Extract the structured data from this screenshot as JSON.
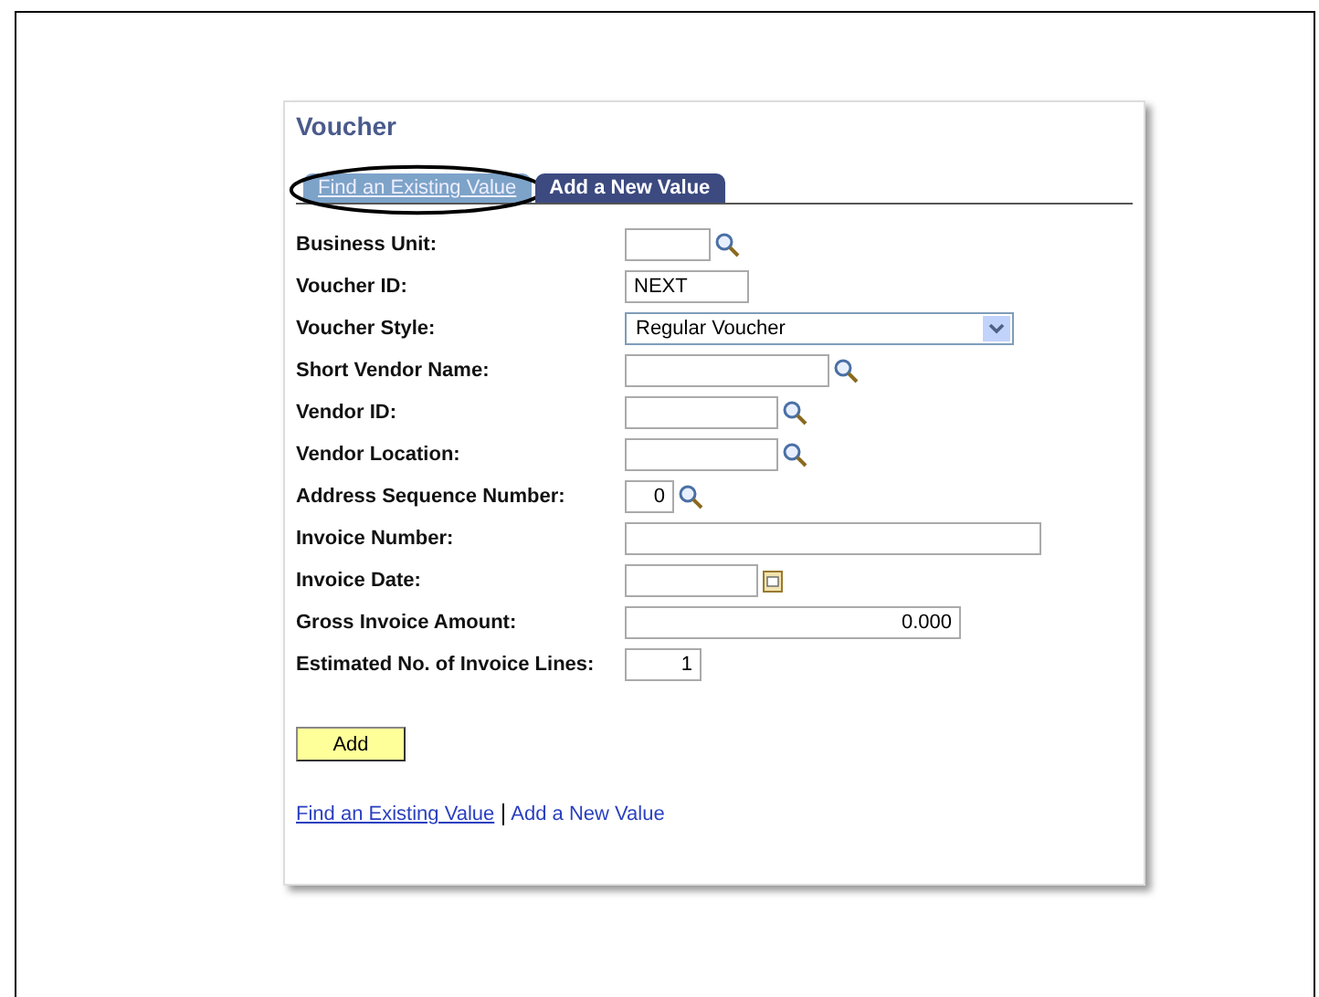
{
  "panel": {
    "title": "Voucher"
  },
  "tabs": [
    {
      "label": "Find an Existing Value",
      "selected": false,
      "circled": true
    },
    {
      "label": "Add a New Value",
      "selected": true,
      "circled": false
    }
  ],
  "fields": [
    {
      "label": "Business Unit:",
      "kind": "lookup"
    },
    {
      "label": "Voucher ID:",
      "kind": "text",
      "value": "NEXT"
    },
    {
      "label": "Voucher Style:",
      "kind": "select",
      "value": "Regular Voucher"
    },
    {
      "label": "Short Vendor Name:",
      "kind": "lookup"
    },
    {
      "label": "Vendor ID:",
      "kind": "lookup"
    },
    {
      "label": "Vendor Location:",
      "kind": "lookup"
    },
    {
      "label": "Address Sequence Number:",
      "kind": "number_lookup",
      "value": "0"
    },
    {
      "label": "Invoice Number:",
      "kind": "text"
    },
    {
      "label": "Invoice Date:",
      "kind": "date"
    },
    {
      "label": "Gross Invoice Amount:",
      "kind": "number",
      "value": "0.000"
    },
    {
      "label": "Estimated No. of Invoice Lines:",
      "kind": "number",
      "value": "1"
    }
  ],
  "add_button": "Add",
  "links": [
    {
      "label": "Find an Existing Value",
      "selected": false
    },
    {
      "label": "Add a New Value",
      "selected": true
    }
  ]
}
